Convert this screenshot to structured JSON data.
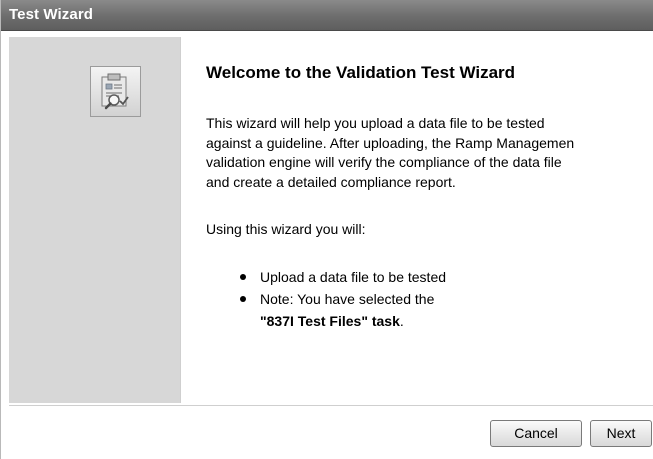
{
  "window": {
    "title": "Test Wizard"
  },
  "content": {
    "heading": "Welcome to the Validation Test Wizard",
    "intro_lines": [
      "This wizard will help you upload a data file to be tested",
      "against a guideline. After uploading, the Ramp Managemen",
      "validation engine will verify the compliance of the data file",
      "and create a detailed compliance report."
    ],
    "using_text": "Using this wizard you will:",
    "bullets": {
      "item1": "Upload a data file to be tested",
      "item2_prefix": "Note: You have selected the",
      "item2_task": "\"837I Test Files\" task",
      "item2_suffix": "."
    }
  },
  "icons": {
    "wizard": "wizard-clipboard-icon"
  },
  "buttons": {
    "cancel": "Cancel",
    "next": "Next"
  },
  "colors": {
    "titlebar": "#6d6d6d",
    "side_panel": "#d7d7d7"
  }
}
